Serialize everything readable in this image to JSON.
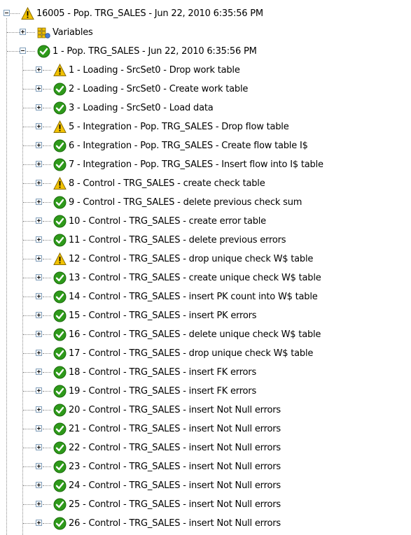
{
  "tree": {
    "root": {
      "label": "16005 - Pop. TRG_SALES - Jun 22, 2010 6:35:56 PM",
      "status": "warning"
    },
    "variables": {
      "label": "Variables",
      "icon": "variables-icon"
    },
    "session": {
      "label": "1 - Pop. TRG_SALES - Jun 22, 2010 6:35:56 PM",
      "status": "success"
    },
    "steps": [
      {
        "label": "1 - Loading - SrcSet0 - Drop work table",
        "status": "warning"
      },
      {
        "label": "2 - Loading - SrcSet0 - Create work table",
        "status": "success"
      },
      {
        "label": "3 - Loading - SrcSet0 - Load data",
        "status": "success"
      },
      {
        "label": "5 - Integration - Pop. TRG_SALES - Drop flow table",
        "status": "warning"
      },
      {
        "label": "6 - Integration - Pop. TRG_SALES - Create flow table I$",
        "status": "success"
      },
      {
        "label": "7 - Integration - Pop. TRG_SALES - Insert flow into I$ table",
        "status": "success"
      },
      {
        "label": "8 - Control - TRG_SALES - create check table",
        "status": "warning"
      },
      {
        "label": "9 - Control - TRG_SALES - delete previous check sum",
        "status": "success"
      },
      {
        "label": "10 - Control - TRG_SALES - create error table",
        "status": "success"
      },
      {
        "label": "11 - Control - TRG_SALES - delete previous errors",
        "status": "success"
      },
      {
        "label": "12 - Control - TRG_SALES - drop unique check W$ table",
        "status": "warning"
      },
      {
        "label": "13 - Control - TRG_SALES - create unique check W$ table",
        "status": "success"
      },
      {
        "label": "14 - Control - TRG_SALES - insert PK count into W$ table",
        "status": "success"
      },
      {
        "label": "15 - Control - TRG_SALES - insert PK errors",
        "status": "success"
      },
      {
        "label": "16 - Control - TRG_SALES - delete unique check W$ table",
        "status": "success"
      },
      {
        "label": "17 - Control - TRG_SALES - drop unique check W$ table",
        "status": "success"
      },
      {
        "label": "18 - Control - TRG_SALES - insert FK errors",
        "status": "success"
      },
      {
        "label": "19 - Control - TRG_SALES - insert FK errors",
        "status": "success"
      },
      {
        "label": "20 - Control - TRG_SALES - insert Not Null errors",
        "status": "success"
      },
      {
        "label": "21 - Control - TRG_SALES - insert Not Null errors",
        "status": "success"
      },
      {
        "label": "22 - Control - TRG_SALES - insert Not Null errors",
        "status": "success"
      },
      {
        "label": "23 - Control - TRG_SALES - insert Not Null errors",
        "status": "success"
      },
      {
        "label": "24 - Control - TRG_SALES - insert Not Null errors",
        "status": "success"
      },
      {
        "label": "25 - Control - TRG_SALES - insert Not Null errors",
        "status": "success"
      },
      {
        "label": "26 - Control - TRG_SALES - insert Not Null errors",
        "status": "success"
      }
    ]
  },
  "colors": {
    "success": "#2e9a1a",
    "warning": "#f2c200",
    "connector": "#8a8a8a",
    "expander_border": "#7f9db9"
  }
}
